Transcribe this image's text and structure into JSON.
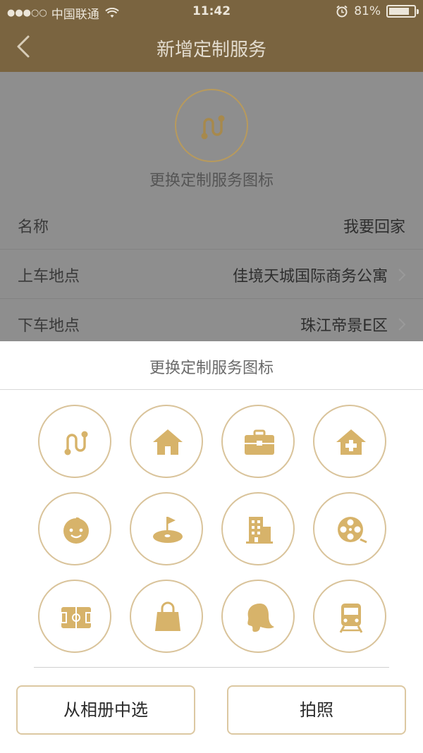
{
  "status_bar": {
    "signal_dots": "●●●○○",
    "carrier": "中国联通",
    "time": "11:42",
    "battery_percent": "81%",
    "battery_level": 0.81
  },
  "nav": {
    "title": "新增定制服务",
    "back_icon": "chevron-left-icon"
  },
  "form": {
    "change_icon_label": "更换定制服务图标",
    "rows": [
      {
        "label": "名称",
        "value": "我要回家"
      },
      {
        "label": "上车地点",
        "value": "佳境天城国际商务公寓"
      },
      {
        "label": "下车地点",
        "value": "珠江帝景E区"
      }
    ]
  },
  "sheet": {
    "title": "更换定制服务图标",
    "icons": [
      "route-icon",
      "home-icon",
      "briefcase-icon",
      "hospital-icon",
      "baby-icon",
      "golf-icon",
      "building-icon",
      "film-reel-icon",
      "soccer-field-icon",
      "shopping-bag-icon",
      "woman-profile-icon",
      "train-icon"
    ],
    "album_button": "从相册中选",
    "photo_button": "拍照"
  },
  "colors": {
    "header": "#7a6440",
    "overlay": "#8e8e8e",
    "gold": "#d7b36a",
    "circle_border": "#d9c39a"
  }
}
